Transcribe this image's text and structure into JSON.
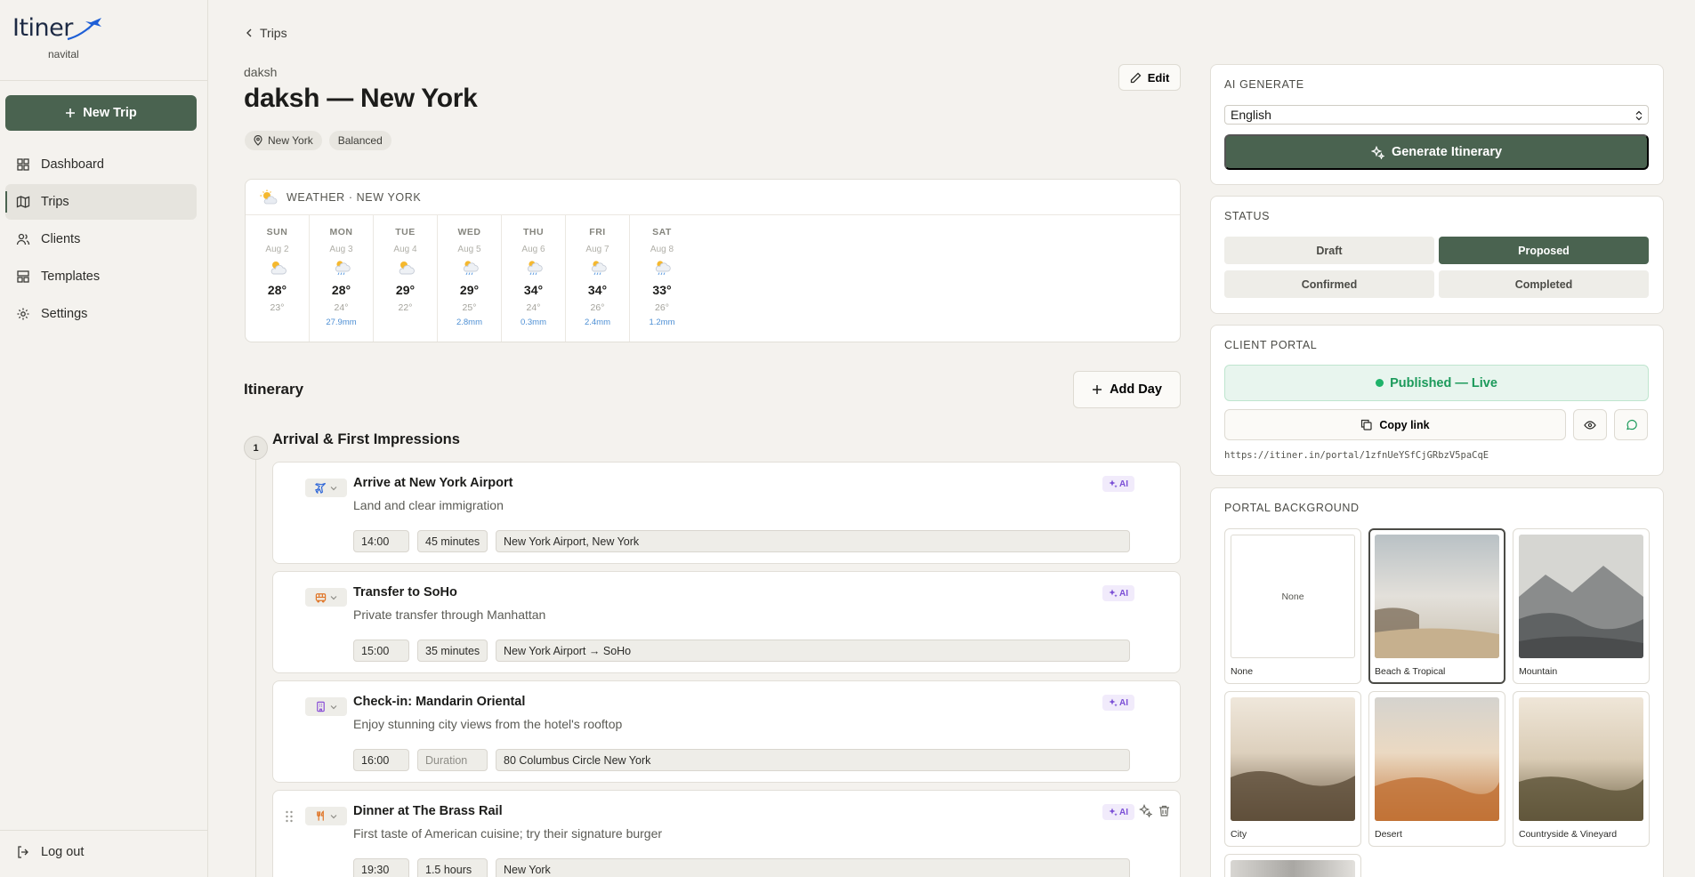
{
  "sidebar": {
    "logo": "Itiner",
    "org": "navital",
    "new_trip": "New Trip",
    "items": [
      {
        "label": "Dashboard",
        "icon": "grid-icon"
      },
      {
        "label": "Trips",
        "icon": "map-icon",
        "active": true
      },
      {
        "label": "Clients",
        "icon": "users-icon"
      },
      {
        "label": "Templates",
        "icon": "layout-icon"
      },
      {
        "label": "Settings",
        "icon": "gear-icon"
      }
    ],
    "logout": "Log out"
  },
  "header": {
    "back": "Trips",
    "client": "daksh",
    "title": "daksh — New York",
    "edit": "Edit",
    "tags": [
      "New York",
      "Balanced"
    ]
  },
  "weather": {
    "title": "WEATHER · NEW YORK",
    "days": [
      {
        "name": "SUN",
        "date": "Aug 2",
        "hi": "28°",
        "lo": "23°",
        "rain": "",
        "icon": "cloud"
      },
      {
        "name": "MON",
        "date": "Aug 3",
        "hi": "28°",
        "lo": "24°",
        "rain": "27.9mm",
        "icon": "rain"
      },
      {
        "name": "TUE",
        "date": "Aug 4",
        "hi": "29°",
        "lo": "22°",
        "rain": "",
        "icon": "cloud"
      },
      {
        "name": "WED",
        "date": "Aug 5",
        "hi": "29°",
        "lo": "25°",
        "rain": "2.8mm",
        "icon": "rain"
      },
      {
        "name": "THU",
        "date": "Aug 6",
        "hi": "34°",
        "lo": "24°",
        "rain": "0.3mm",
        "icon": "rain"
      },
      {
        "name": "FRI",
        "date": "Aug 7",
        "hi": "34°",
        "lo": "26°",
        "rain": "2.4mm",
        "icon": "rain"
      },
      {
        "name": "SAT",
        "date": "Aug 8",
        "hi": "33°",
        "lo": "26°",
        "rain": "1.2mm",
        "icon": "rain"
      }
    ]
  },
  "itinerary": {
    "title": "Itinerary",
    "add_day": "Add Day",
    "day_number": "1",
    "day_title": "Arrival & First Impressions",
    "ai_label": "AI",
    "activities": [
      {
        "title": "Arrive at New York Airport",
        "desc": "Land and clear immigration",
        "time": "14:00",
        "duration": "45 minutes",
        "location": "New York Airport, New York",
        "type": "flight"
      },
      {
        "title": "Transfer to SoHo",
        "desc": "Private transfer through Manhattan",
        "time": "15:00",
        "duration": "35 minutes",
        "location": "New York Airport → SoHo",
        "type": "transfer"
      },
      {
        "title": "Check-in: Mandarin Oriental",
        "desc": "Enjoy stunning city views from the hotel's rooftop",
        "time": "16:00",
        "duration": "",
        "duration_placeholder": "Duration",
        "location": "80 Columbus Circle New York",
        "type": "hotel"
      },
      {
        "title": "Dinner at The Brass Rail",
        "desc": "First taste of American cuisine; try their signature burger",
        "time": "19:30",
        "duration": "1.5 hours",
        "location": "New York",
        "type": "dining"
      }
    ]
  },
  "ai_generate": {
    "title": "AI GENERATE",
    "language": "English",
    "button": "Generate Itinerary"
  },
  "status": {
    "title": "STATUS",
    "options": [
      "Draft",
      "Proposed",
      "Confirmed",
      "Completed"
    ],
    "selected": "Proposed"
  },
  "portal": {
    "title": "CLIENT PORTAL",
    "published": "Published — Live",
    "copy": "Copy link",
    "url": "https://itiner.in/portal/1zfnUeYSfCjGRbzV5paCqE"
  },
  "background": {
    "title": "PORTAL BACKGROUND",
    "none_text": "None",
    "options": [
      "None",
      "Beach & Tropical",
      "Mountain",
      "City",
      "Desert",
      "Countryside & Vineyard"
    ],
    "selected": "Beach & Tropical"
  },
  "colors": {
    "accent": "#4a6350",
    "live": "#1c9a5b",
    "ai": "#7b4fd6",
    "rain": "#4d8fd4"
  }
}
